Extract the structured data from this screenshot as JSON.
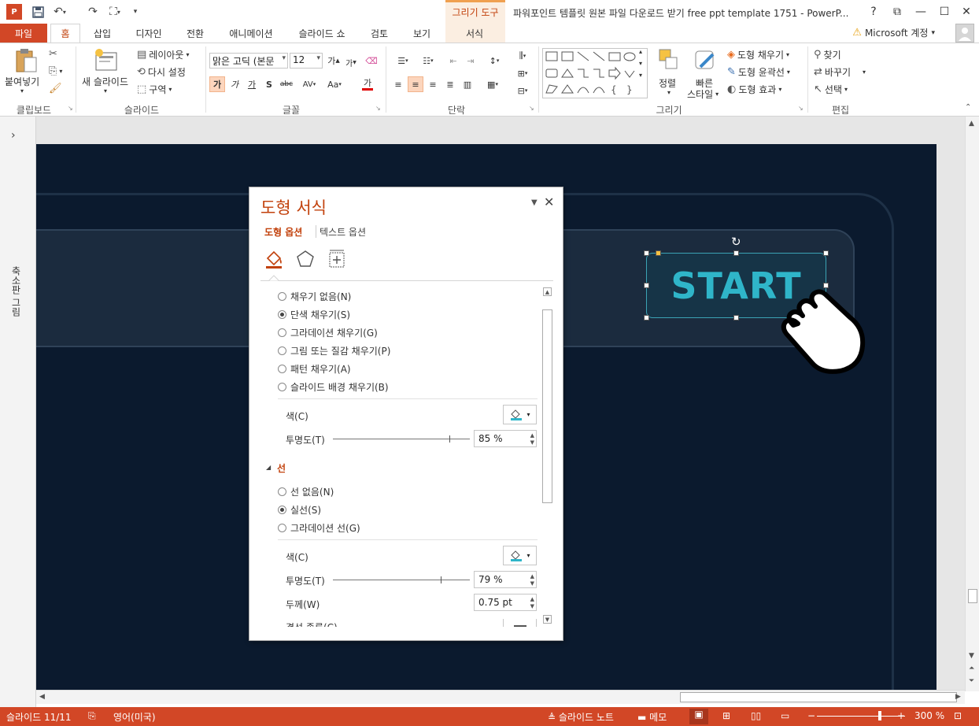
{
  "app": {
    "title": "파워포인트 템플릿 원본 파일 다운로드 받기 free ppt template 1751 - PowerP...",
    "accent_color": "#d24726",
    "context_tab_group": "그리기 도구"
  },
  "window_controls": {
    "help": "?",
    "ribbon_display": "⧉",
    "minimize": "—",
    "restore": "☐",
    "close": "✕"
  },
  "tabs": {
    "file": "파일",
    "items": [
      "홈",
      "삽입",
      "디자인",
      "전환",
      "애니메이션",
      "슬라이드 쇼",
      "검토",
      "보기",
      "서식"
    ],
    "active": "홈"
  },
  "account": {
    "label": "Microsoft 계정",
    "dropdown": "▾"
  },
  "ribbon": {
    "clipboard": {
      "paste": "붙여넣기",
      "group": "클립보드"
    },
    "slides": {
      "new_slide": "새 슬라이드",
      "layout": "레이아웃",
      "reset": "다시 설정",
      "section": "구역",
      "group": "슬라이드"
    },
    "font": {
      "font_name": "맑은 고딕 (본문",
      "font_size": "12",
      "bold": "가",
      "italic": "가",
      "underline": "가",
      "shadow": "S",
      "strike": "abc",
      "spacing": "AV",
      "case": "Aa",
      "color": "가",
      "grow": "가",
      "shrink": "가",
      "group": "글꼴"
    },
    "paragraph": {
      "group": "단락"
    },
    "drawing": {
      "arrange": "정렬",
      "quick_styles": "빠른",
      "quick_styles_2": "스타일",
      "fill": "도형 채우기",
      "outline": "도형 윤곽선",
      "effects": "도형 효과",
      "group": "그리기"
    },
    "editing": {
      "find": "찾기",
      "replace": "바꾸기",
      "select": "선택",
      "group": "편집"
    }
  },
  "left_pane": {
    "label": "축소판 그림",
    "expand": "›"
  },
  "slide": {
    "start_text": "START"
  },
  "format_pane": {
    "title": "도형 서식",
    "tab_shape": "도형 옵션",
    "tab_text": "텍스트 옵션",
    "fill_options": [
      {
        "label": "채우기 없음(N)",
        "selected": false
      },
      {
        "label": "단색 채우기(S)",
        "selected": true
      },
      {
        "label": "그라데이션 채우기(G)",
        "selected": false
      },
      {
        "label": "그림 또는 질감 채우기(P)",
        "selected": false
      },
      {
        "label": "패턴 채우기(A)",
        "selected": false
      },
      {
        "label": "슬라이드 배경 채우기(B)",
        "selected": false
      }
    ],
    "fill_color_label": "색(C)",
    "fill_transparency_label": "투명도(T)",
    "fill_transparency_value": "85 %",
    "fill_transparency": 0.85,
    "line_section": "선",
    "line_options": [
      {
        "label": "선 없음(N)",
        "selected": false
      },
      {
        "label": "실선(S)",
        "selected": true
      },
      {
        "label": "그라데이션 선(G)",
        "selected": false
      }
    ],
    "line_color_label": "색(C)",
    "line_transparency_label": "투명도(T)",
    "line_transparency_value": "79 %",
    "line_transparency": 0.79,
    "width_label": "두께(W)",
    "width_value": "0.75 pt",
    "compound_label": "겹선 종류(C)"
  },
  "status": {
    "slide": "슬라이드 11/11",
    "language": "영어(미국)",
    "notes": "슬라이드 노트",
    "comments": "메모",
    "zoom": "300 %"
  }
}
